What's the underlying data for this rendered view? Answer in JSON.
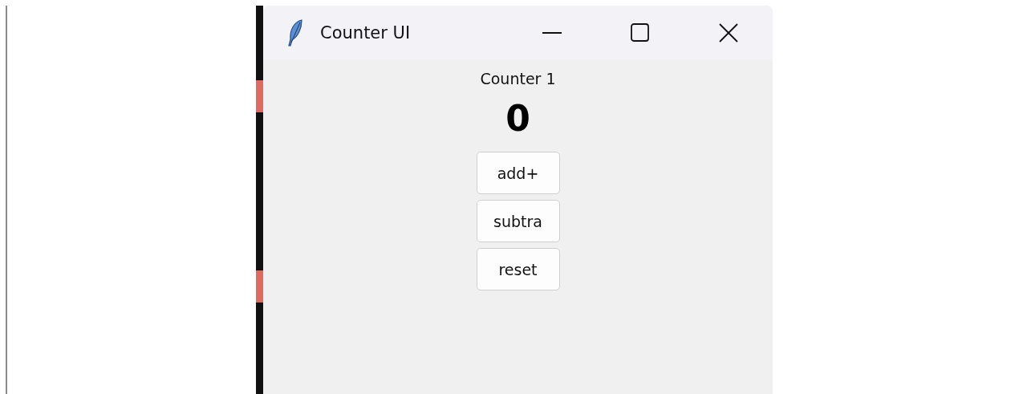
{
  "window": {
    "title": "Counter UI"
  },
  "counter": {
    "label": "Counter 1",
    "value": "0"
  },
  "buttons": [
    {
      "label": "add+"
    },
    {
      "label": "subtra"
    },
    {
      "label": "reset"
    }
  ]
}
